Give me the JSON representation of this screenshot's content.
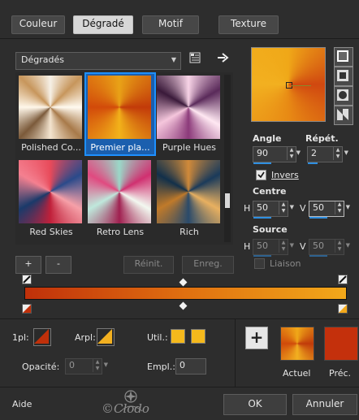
{
  "tabs": [
    "Couleur",
    "Dégradé",
    "Motif",
    "Texture"
  ],
  "active_tab": "Dégradé",
  "category": {
    "value": "Dégradés"
  },
  "gallery": [
    {
      "label": "Polished Co...",
      "selected": false
    },
    {
      "label": "Premier pla...",
      "selected": true
    },
    {
      "label": "Purple Hues",
      "selected": false
    },
    {
      "label": "Red Skies",
      "selected": false
    },
    {
      "label": "Retro Lens",
      "selected": false
    },
    {
      "label": "Rich",
      "selected": false
    }
  ],
  "gallery_buttons": {
    "add": "+",
    "remove": "-",
    "reset": "Réinit.",
    "save": "Enreg."
  },
  "angle": {
    "label": "Angle",
    "value": "90"
  },
  "repeat": {
    "label": "Répét.",
    "value": "2"
  },
  "invert": {
    "label": "Invers",
    "checked": true
  },
  "center": {
    "label": "Centre",
    "h_label": "H",
    "h_value": "50",
    "v_label": "V",
    "v_value": "50"
  },
  "source": {
    "label": "Source",
    "h_label": "H",
    "h_value": "50",
    "v_label": "V",
    "v_value": "50"
  },
  "link": {
    "label": "Liaison",
    "checked": false
  },
  "gradient_colors": {
    "start": "#c0300a",
    "end": "#f7b31a",
    "accent": "#1e90ff"
  },
  "bottom": {
    "first_plane_label": "1pl:",
    "bg_plane_label": "Arpl:",
    "util_label": "Util.:",
    "opacity_label": "Opacité:",
    "opacity_value": "0",
    "location_label": "Empl.:",
    "location_value": "0",
    "current_label": "Actuel",
    "previous_label": "Préc.",
    "add_button": "+"
  },
  "footer": {
    "help": "Aide",
    "ok": "OK",
    "cancel": "Annuler"
  },
  "watermark": "©Clodo",
  "icons": {
    "list_view": "list-icon",
    "arrow": "arrow-right-icon"
  }
}
